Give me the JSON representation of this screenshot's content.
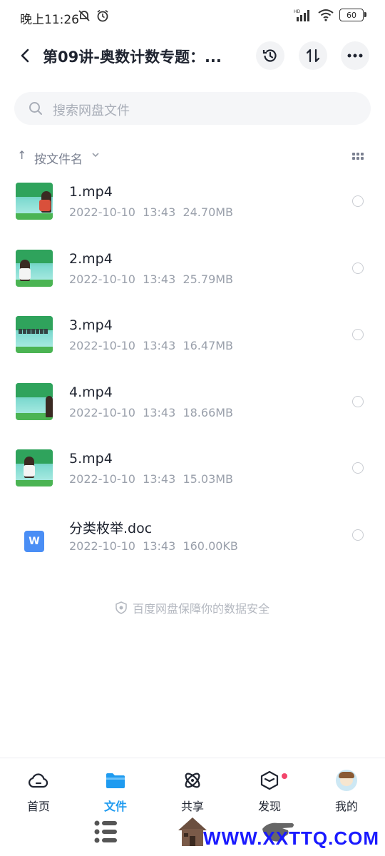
{
  "status_bar": {
    "time": "晚上11:26",
    "battery": "60"
  },
  "header": {
    "title": "第09讲-奥数计数专题：..."
  },
  "search": {
    "placeholder": "搜索网盘文件"
  },
  "sort": {
    "label": "按文件名"
  },
  "files": [
    {
      "name": "1.mp4",
      "date": "2022-10-10",
      "time": "13:43",
      "size": "24.70MB",
      "type": "video"
    },
    {
      "name": "2.mp4",
      "date": "2022-10-10",
      "time": "13:43",
      "size": "25.79MB",
      "type": "video"
    },
    {
      "name": "3.mp4",
      "date": "2022-10-10",
      "time": "13:43",
      "size": "16.47MB",
      "type": "video"
    },
    {
      "name": "4.mp4",
      "date": "2022-10-10",
      "time": "13:43",
      "size": "18.66MB",
      "type": "video"
    },
    {
      "name": "5.mp4",
      "date": "2022-10-10",
      "time": "13:43",
      "size": "15.03MB",
      "type": "video"
    },
    {
      "name": "分类枚举.doc",
      "date": "2022-10-10",
      "time": "13:43",
      "size": "160.00KB",
      "type": "doc"
    }
  ],
  "footer_note": "百度网盘保障你的数据安全",
  "tabs": [
    {
      "label": "首页",
      "icon": "cloud-home-icon"
    },
    {
      "label": "文件",
      "icon": "folder-icon"
    },
    {
      "label": "共享",
      "icon": "atom-share-icon"
    },
    {
      "label": "发现",
      "icon": "cube-discover-icon"
    },
    {
      "label": "我的",
      "icon": "avatar-icon"
    }
  ],
  "watermark": "WWW.XXTTQ.COM",
  "colors": {
    "accent": "#1f9bf0",
    "badge": "#f2456b",
    "doc": "#4a8ef5"
  }
}
